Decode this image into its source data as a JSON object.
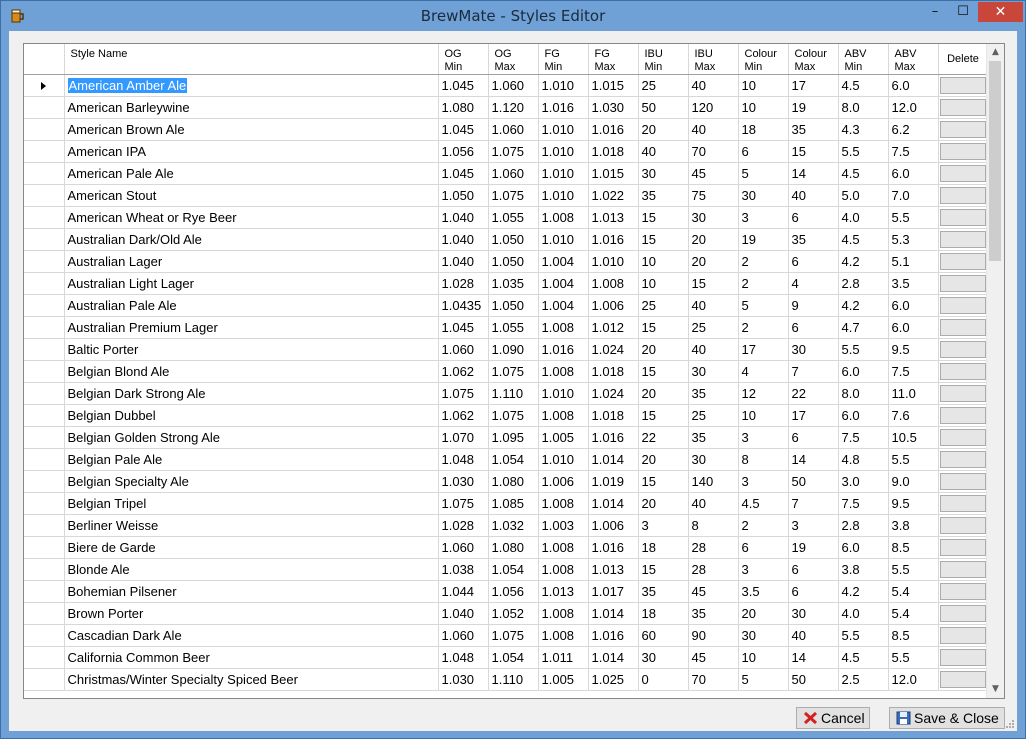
{
  "window": {
    "title": "BrewMate - Styles Editor"
  },
  "title_buttons": {
    "minimize": "–",
    "maximize": "☐",
    "close": "✕"
  },
  "grid": {
    "headers": [
      "Style Name",
      "OG\nMin",
      "OG\nMax",
      "FG\nMin",
      "FG\nMax",
      "IBU\nMin",
      "IBU\nMax",
      "Colour\nMin",
      "Colour\nMax",
      "ABV\nMin",
      "ABV\nMax",
      "Delete"
    ],
    "selected_row": 0,
    "rows": [
      [
        "American Amber Ale",
        "1.045",
        "1.060",
        "1.010",
        "1.015",
        "25",
        "40",
        "10",
        "17",
        "4.5",
        "6.0"
      ],
      [
        "American Barleywine",
        "1.080",
        "1.120",
        "1.016",
        "1.030",
        "50",
        "120",
        "10",
        "19",
        "8.0",
        "12.0"
      ],
      [
        "American Brown Ale",
        "1.045",
        "1.060",
        "1.010",
        "1.016",
        "20",
        "40",
        "18",
        "35",
        "4.3",
        "6.2"
      ],
      [
        "American IPA",
        "1.056",
        "1.075",
        "1.010",
        "1.018",
        "40",
        "70",
        "6",
        "15",
        "5.5",
        "7.5"
      ],
      [
        "American Pale Ale",
        "1.045",
        "1.060",
        "1.010",
        "1.015",
        "30",
        "45",
        "5",
        "14",
        "4.5",
        "6.0"
      ],
      [
        "American Stout",
        "1.050",
        "1.075",
        "1.010",
        "1.022",
        "35",
        "75",
        "30",
        "40",
        "5.0",
        "7.0"
      ],
      [
        "American Wheat or Rye Beer",
        "1.040",
        "1.055",
        "1.008",
        "1.013",
        "15",
        "30",
        "3",
        "6",
        "4.0",
        "5.5"
      ],
      [
        "Australian Dark/Old Ale",
        "1.040",
        "1.050",
        "1.010",
        "1.016",
        "15",
        "20",
        "19",
        "35",
        "4.5",
        "5.3"
      ],
      [
        "Australian Lager",
        "1.040",
        "1.050",
        "1.004",
        "1.010",
        "10",
        "20",
        "2",
        "6",
        "4.2",
        "5.1"
      ],
      [
        "Australian Light Lager",
        "1.028",
        "1.035",
        "1.004",
        "1.008",
        "10",
        "15",
        "2",
        "4",
        "2.8",
        "3.5"
      ],
      [
        "Australian Pale Ale",
        "1.0435",
        "1.050",
        "1.004",
        "1.006",
        "25",
        "40",
        "5",
        "9",
        "4.2",
        "6.0"
      ],
      [
        "Australian Premium Lager",
        "1.045",
        "1.055",
        "1.008",
        "1.012",
        "15",
        "25",
        "2",
        "6",
        "4.7",
        "6.0"
      ],
      [
        "Baltic Porter",
        "1.060",
        "1.090",
        "1.016",
        "1.024",
        "20",
        "40",
        "17",
        "30",
        "5.5",
        "9.5"
      ],
      [
        "Belgian Blond Ale",
        "1.062",
        "1.075",
        "1.008",
        "1.018",
        "15",
        "30",
        "4",
        "7",
        "6.0",
        "7.5"
      ],
      [
        "Belgian Dark Strong Ale",
        "1.075",
        "1.110",
        "1.010",
        "1.024",
        "20",
        "35",
        "12",
        "22",
        "8.0",
        "11.0"
      ],
      [
        "Belgian Dubbel",
        "1.062",
        "1.075",
        "1.008",
        "1.018",
        "15",
        "25",
        "10",
        "17",
        "6.0",
        "7.6"
      ],
      [
        "Belgian Golden Strong Ale",
        "1.070",
        "1.095",
        "1.005",
        "1.016",
        "22",
        "35",
        "3",
        "6",
        "7.5",
        "10.5"
      ],
      [
        "Belgian Pale Ale",
        "1.048",
        "1.054",
        "1.010",
        "1.014",
        "20",
        "30",
        "8",
        "14",
        "4.8",
        "5.5"
      ],
      [
        "Belgian Specialty Ale",
        "1.030",
        "1.080",
        "1.006",
        "1.019",
        "15",
        "140",
        "3",
        "50",
        "3.0",
        "9.0"
      ],
      [
        "Belgian Tripel",
        "1.075",
        "1.085",
        "1.008",
        "1.014",
        "20",
        "40",
        "4.5",
        "7",
        "7.5",
        "9.5"
      ],
      [
        "Berliner Weisse",
        "1.028",
        "1.032",
        "1.003",
        "1.006",
        "3",
        "8",
        "2",
        "3",
        "2.8",
        "3.8"
      ],
      [
        "Biere de Garde",
        "1.060",
        "1.080",
        "1.008",
        "1.016",
        "18",
        "28",
        "6",
        "19",
        "6.0",
        "8.5"
      ],
      [
        "Blonde Ale",
        "1.038",
        "1.054",
        "1.008",
        "1.013",
        "15",
        "28",
        "3",
        "6",
        "3.8",
        "5.5"
      ],
      [
        "Bohemian Pilsener",
        "1.044",
        "1.056",
        "1.013",
        "1.017",
        "35",
        "45",
        "3.5",
        "6",
        "4.2",
        "5.4"
      ],
      [
        "Brown Porter",
        "1.040",
        "1.052",
        "1.008",
        "1.014",
        "18",
        "35",
        "20",
        "30",
        "4.0",
        "5.4"
      ],
      [
        "Cascadian Dark Ale",
        "1.060",
        "1.075",
        "1.008",
        "1.016",
        "60",
        "90",
        "30",
        "40",
        "5.5",
        "8.5"
      ],
      [
        "California Common Beer",
        "1.048",
        "1.054",
        "1.011",
        "1.014",
        "30",
        "45",
        "10",
        "14",
        "4.5",
        "5.5"
      ],
      [
        "Christmas/Winter Specialty Spiced Beer",
        "1.030",
        "1.110",
        "1.005",
        "1.025",
        "0",
        "70",
        "5",
        "50",
        "2.5",
        "12.0"
      ]
    ]
  },
  "buttons": {
    "cancel": "Cancel",
    "save_close": "Save & Close"
  }
}
